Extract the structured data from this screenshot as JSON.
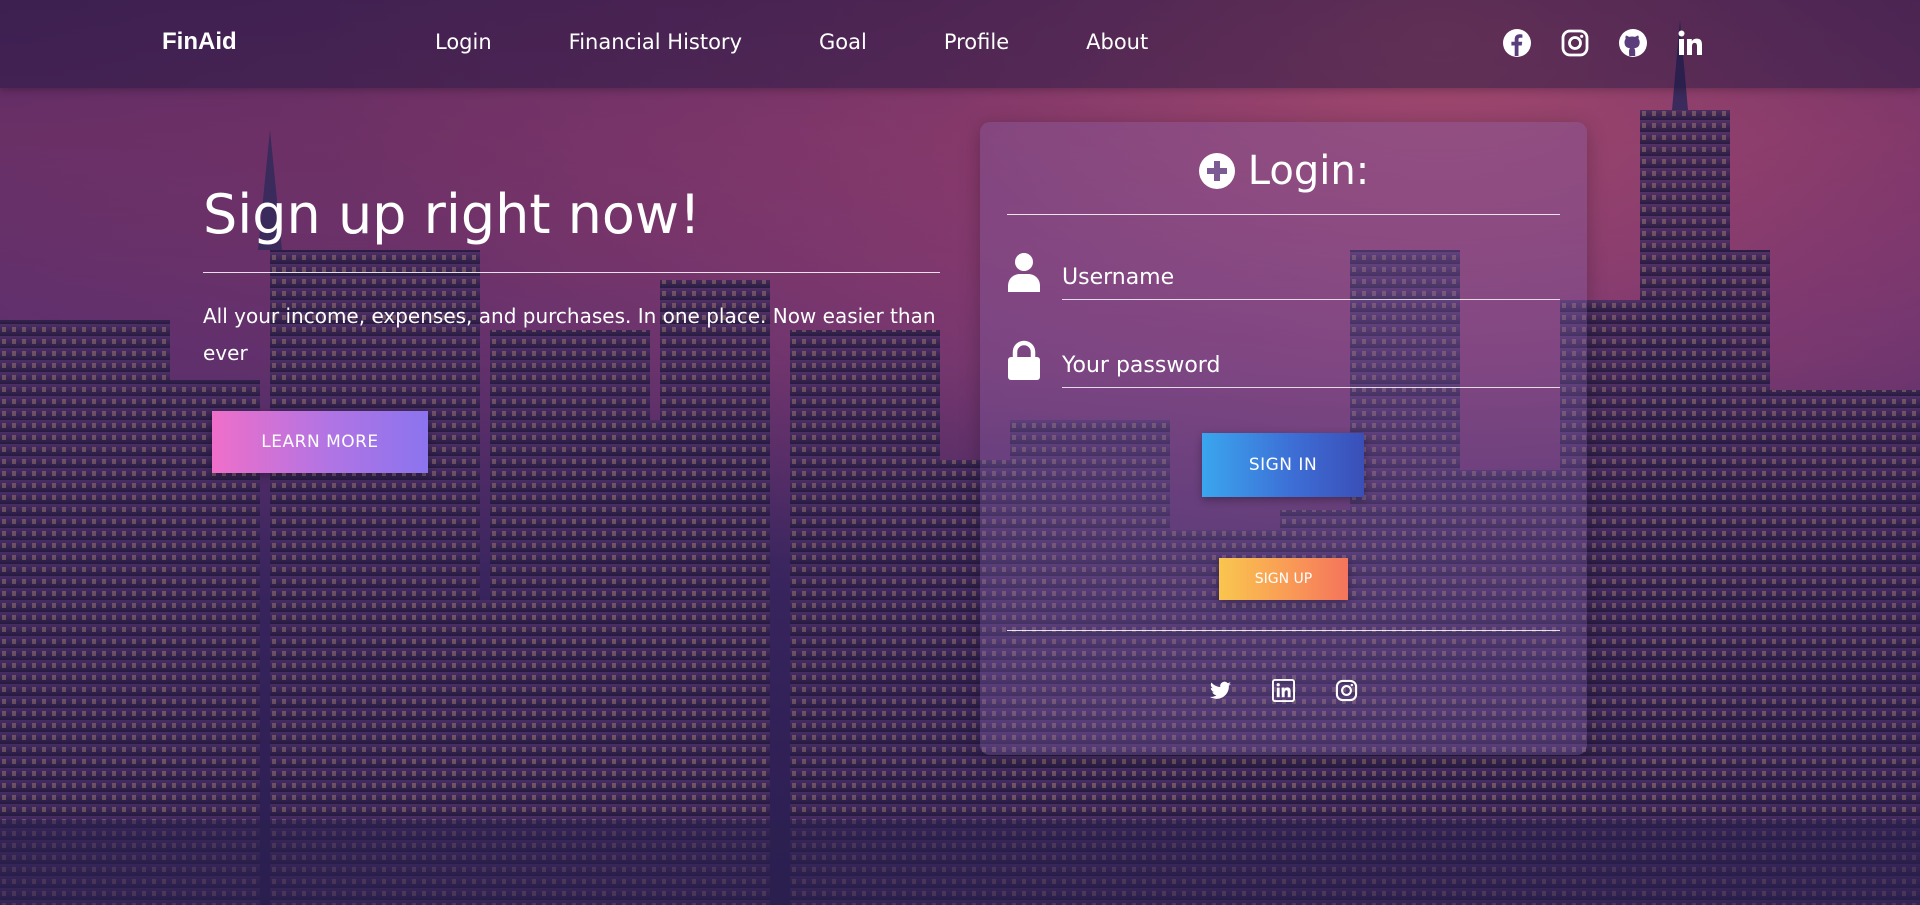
{
  "nav": {
    "brand": "FinAid",
    "links": [
      "Login",
      "Financial History",
      "Goal",
      "Profile",
      "About"
    ],
    "social_icons": [
      "facebook-icon",
      "instagram-icon",
      "github-icon",
      "linkedin-icon"
    ]
  },
  "hero": {
    "title": "Sign up right now!",
    "text": "All your income, expenses, and purchases. In one place. Now easier than ever",
    "learn_more": "LEARN MORE"
  },
  "login": {
    "title": "Login:",
    "username_placeholder": "Username",
    "password_placeholder": "Your password",
    "sign_in": "SIGN IN",
    "sign_up": "SIGN UP",
    "social_icons": [
      "twitter-icon",
      "linkedin-icon",
      "instagram-icon"
    ]
  },
  "colors": {
    "learn_more_gradient": [
      "#ef6fc9",
      "#8b74ee"
    ],
    "sign_in_gradient": [
      "#3aa6ee",
      "#3a4fb8"
    ],
    "sign_up_gradient": [
      "#f9c64e",
      "#f4745c"
    ]
  }
}
